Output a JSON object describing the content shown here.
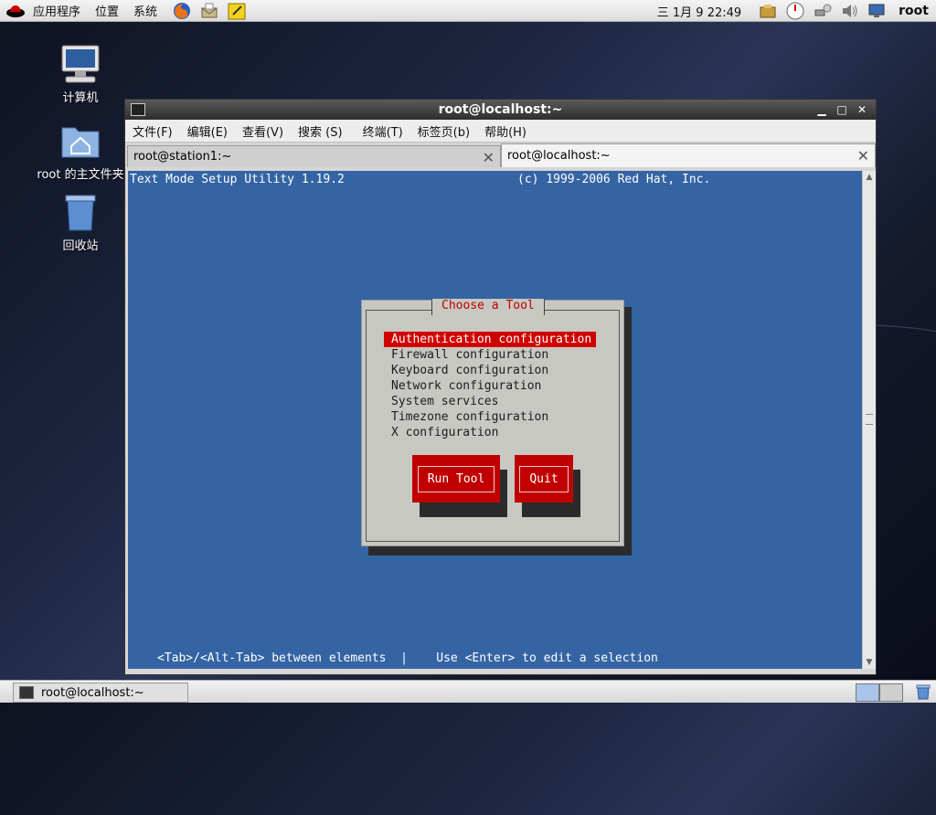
{
  "top_panel": {
    "menus": [
      "应用程序",
      "位置",
      "系统"
    ],
    "clock": "三  1月  9 22:49",
    "user": "root"
  },
  "desktop": {
    "icons": [
      {
        "label": "计算机"
      },
      {
        "label": "root 的主文件夹"
      },
      {
        "label": "回收站"
      }
    ]
  },
  "terminal": {
    "title": "root@localhost:~",
    "menu": [
      "文件(F)",
      "编辑(E)",
      "查看(V)",
      "搜索 (S)",
      "终端(T)",
      "标签页(b)",
      "帮助(H)"
    ],
    "tabs": [
      {
        "label": "root@station1:~",
        "active": false
      },
      {
        "label": "root@localhost:~",
        "active": true
      }
    ],
    "header_left": "Text Mode Setup Utility 1.19.2",
    "header_right": "(c) 1999-2006 Red Hat, Inc.",
    "dialog": {
      "title": "Choose a Tool",
      "items": [
        "Authentication configuration",
        "Firewall configuration",
        "Keyboard configuration",
        "Network configuration",
        "System services",
        "Timezone configuration",
        "X configuration"
      ],
      "selected_index": 0,
      "run_button": "Run Tool",
      "quit_button": "Quit"
    },
    "footer": "<Tab>/<Alt-Tab> between elements  |    Use <Enter> to edit a selection"
  },
  "bottom_panel": {
    "task": "root@localhost:~"
  },
  "colors": {
    "terminal_bg": "#3464a3",
    "dialog_bg": "#c8c8c2",
    "accent_red": "#c00000"
  }
}
